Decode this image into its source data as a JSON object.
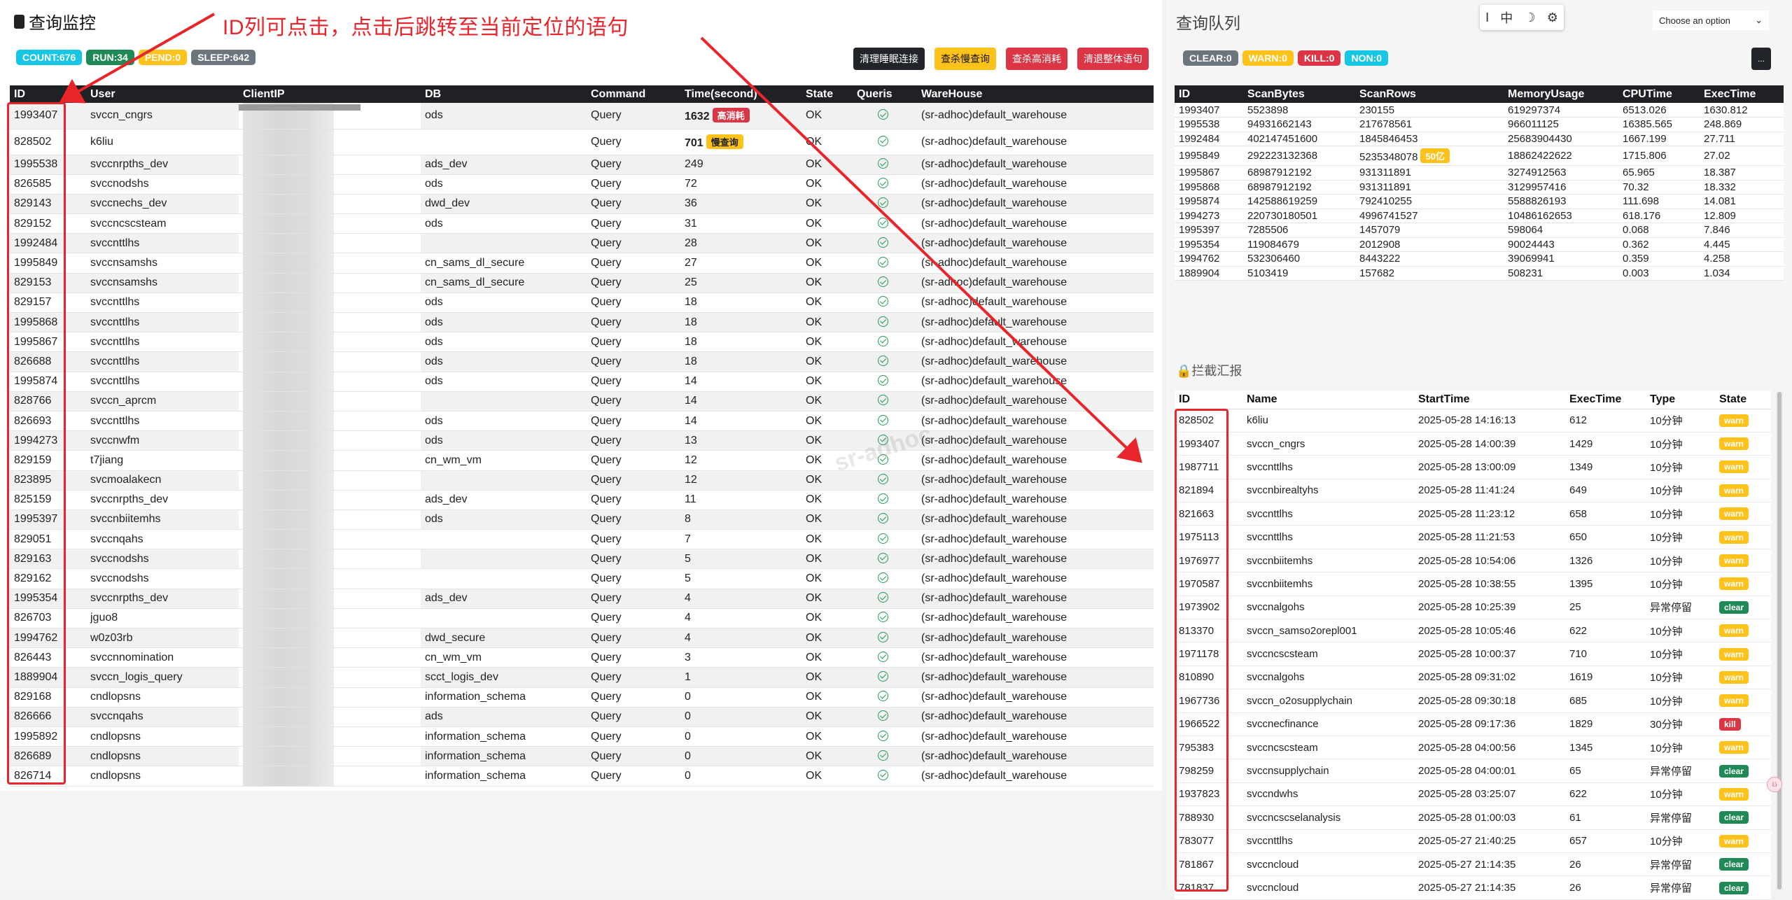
{
  "monitor": {
    "title": "查询监控",
    "annotation": "ID列可点击，点击后跳转至当前定位的语句",
    "badges": {
      "count": "COUNT:676",
      "run": "RUN:34",
      "pend": "PEND:0",
      "sleep": "SLEEP:642"
    },
    "buttons": {
      "clean_sleep": "清理睡眠连接",
      "check_slow": "查杀慢查询",
      "check_high": "查杀高消耗",
      "clean_all": "清退整体语句"
    },
    "columns": [
      "ID",
      "User",
      "ClientIP",
      "DB",
      "Command",
      "Time(second)",
      "State",
      "Queris",
      "WareHouse"
    ],
    "rows": [
      {
        "id": "1993407",
        "user": "svccn_cngrs",
        "db": "ods",
        "cmd": "Query",
        "time": "1632",
        "tag": "高消耗",
        "state": "OK",
        "wh": "(sr-adhoc)default_warehouse"
      },
      {
        "id": "828502",
        "user": "k6liu",
        "db": "",
        "cmd": "Query",
        "time": "701",
        "tag": "慢查询",
        "state": "OK",
        "wh": "(sr-adhoc)default_warehouse"
      },
      {
        "id": "1995538",
        "user": "svccnrpths_dev",
        "db": "ads_dev",
        "cmd": "Query",
        "time": "249",
        "tag": "",
        "state": "OK",
        "wh": "(sr-adhoc)default_warehouse"
      },
      {
        "id": "826585",
        "user": "svccnodshs",
        "db": "ods",
        "cmd": "Query",
        "time": "72",
        "tag": "",
        "state": "OK",
        "wh": "(sr-adhoc)default_warehouse"
      },
      {
        "id": "829143",
        "user": "svccnechs_dev",
        "db": "dwd_dev",
        "cmd": "Query",
        "time": "36",
        "tag": "",
        "state": "OK",
        "wh": "(sr-adhoc)default_warehouse"
      },
      {
        "id": "829152",
        "user": "svccncscsteam",
        "db": "ods",
        "cmd": "Query",
        "time": "31",
        "tag": "",
        "state": "OK",
        "wh": "(sr-adhoc)default_warehouse"
      },
      {
        "id": "1992484",
        "user": "svccnttlhs",
        "db": "",
        "cmd": "Query",
        "time": "28",
        "tag": "",
        "state": "OK",
        "wh": "(sr-adhoc)default_warehouse"
      },
      {
        "id": "1995849",
        "user": "svccnsamshs",
        "db": "cn_sams_dl_secure",
        "cmd": "Query",
        "time": "27",
        "tag": "",
        "state": "OK",
        "wh": "(sr-adhoc)default_warehouse"
      },
      {
        "id": "829153",
        "user": "svccnsamshs",
        "db": "cn_sams_dl_secure",
        "cmd": "Query",
        "time": "25",
        "tag": "",
        "state": "OK",
        "wh": "(sr-adhoc)default_warehouse"
      },
      {
        "id": "829157",
        "user": "svccnttlhs",
        "db": "ods",
        "cmd": "Query",
        "time": "18",
        "tag": "",
        "state": "OK",
        "wh": "(sr-adhoc)default_warehouse"
      },
      {
        "id": "1995868",
        "user": "svccnttlhs",
        "db": "ods",
        "cmd": "Query",
        "time": "18",
        "tag": "",
        "state": "OK",
        "wh": "(sr-adhoc)default_warehouse"
      },
      {
        "id": "1995867",
        "user": "svccnttlhs",
        "db": "ods",
        "cmd": "Query",
        "time": "18",
        "tag": "",
        "state": "OK",
        "wh": "(sr-adhoc)default_warehouse"
      },
      {
        "id": "826688",
        "user": "svccnttlhs",
        "db": "ods",
        "cmd": "Query",
        "time": "18",
        "tag": "",
        "state": "OK",
        "wh": "(sr-adhoc)default_warehouse"
      },
      {
        "id": "1995874",
        "user": "svccnttlhs",
        "db": "ods",
        "cmd": "Query",
        "time": "14",
        "tag": "",
        "state": "OK",
        "wh": "(sr-adhoc)default_warehouse"
      },
      {
        "id": "828766",
        "user": "svccn_aprcm",
        "db": "",
        "cmd": "Query",
        "time": "14",
        "tag": "",
        "state": "OK",
        "wh": "(sr-adhoc)default_warehouse"
      },
      {
        "id": "826693",
        "user": "svccnttlhs",
        "db": "ods",
        "cmd": "Query",
        "time": "14",
        "tag": "",
        "state": "OK",
        "wh": "(sr-adhoc)default_warehouse"
      },
      {
        "id": "1994273",
        "user": "svccnwfm",
        "db": "ods",
        "cmd": "Query",
        "time": "13",
        "tag": "",
        "state": "OK",
        "wh": "(sr-adhoc)default_warehouse"
      },
      {
        "id": "829159",
        "user": "t7jiang",
        "db": "cn_wm_vm",
        "cmd": "Query",
        "time": "12",
        "tag": "",
        "state": "OK",
        "wh": "(sr-adhoc)default_warehouse"
      },
      {
        "id": "823895",
        "user": "svcmoalakecn",
        "db": "",
        "cmd": "Query",
        "time": "12",
        "tag": "",
        "state": "OK",
        "wh": "(sr-adhoc)default_warehouse"
      },
      {
        "id": "825159",
        "user": "svccnrpths_dev",
        "db": "ads_dev",
        "cmd": "Query",
        "time": "11",
        "tag": "",
        "state": "OK",
        "wh": "(sr-adhoc)default_warehouse"
      },
      {
        "id": "1995397",
        "user": "svccnbiitemhs",
        "db": "ods",
        "cmd": "Query",
        "time": "8",
        "tag": "",
        "state": "OK",
        "wh": "(sr-adhoc)default_warehouse"
      },
      {
        "id": "829051",
        "user": "svccnqahs",
        "db": "",
        "cmd": "Query",
        "time": "7",
        "tag": "",
        "state": "OK",
        "wh": "(sr-adhoc)default_warehouse"
      },
      {
        "id": "829163",
        "user": "svccnodshs",
        "db": "",
        "cmd": "Query",
        "time": "5",
        "tag": "",
        "state": "OK",
        "wh": "(sr-adhoc)default_warehouse"
      },
      {
        "id": "829162",
        "user": "svccnodshs",
        "db": "",
        "cmd": "Query",
        "time": "5",
        "tag": "",
        "state": "OK",
        "wh": "(sr-adhoc)default_warehouse"
      },
      {
        "id": "1995354",
        "user": "svccnrpths_dev",
        "db": "ads_dev",
        "cmd": "Query",
        "time": "4",
        "tag": "",
        "state": "OK",
        "wh": "(sr-adhoc)default_warehouse"
      },
      {
        "id": "826703",
        "user": "jguo8",
        "db": "",
        "cmd": "Query",
        "time": "4",
        "tag": "",
        "state": "OK",
        "wh": "(sr-adhoc)default_warehouse"
      },
      {
        "id": "1994762",
        "user": "w0z03rb",
        "db": "dwd_secure",
        "cmd": "Query",
        "time": "4",
        "tag": "",
        "state": "OK",
        "wh": "(sr-adhoc)default_warehouse"
      },
      {
        "id": "826443",
        "user": "svccnnomination",
        "db": "cn_wm_vm",
        "cmd": "Query",
        "time": "3",
        "tag": "",
        "state": "OK",
        "wh": "(sr-adhoc)default_warehouse"
      },
      {
        "id": "1889904",
        "user": "svccn_logis_query",
        "db": "scct_logis_dev",
        "cmd": "Query",
        "time": "1",
        "tag": "",
        "state": "OK",
        "wh": "(sr-adhoc)default_warehouse"
      },
      {
        "id": "829168",
        "user": "cndlopsns",
        "db": "information_schema",
        "cmd": "Query",
        "time": "0",
        "tag": "",
        "state": "OK",
        "wh": "(sr-adhoc)default_warehouse"
      },
      {
        "id": "826666",
        "user": "svccnqahs",
        "db": "ads",
        "cmd": "Query",
        "time": "0",
        "tag": "",
        "state": "OK",
        "wh": "(sr-adhoc)default_warehouse"
      },
      {
        "id": "1995892",
        "user": "cndlopsns",
        "db": "information_schema",
        "cmd": "Query",
        "time": "0",
        "tag": "",
        "state": "OK",
        "wh": "(sr-adhoc)default_warehouse"
      },
      {
        "id": "826689",
        "user": "cndlopsns",
        "db": "information_schema",
        "cmd": "Query",
        "time": "0",
        "tag": "",
        "state": "OK",
        "wh": "(sr-adhoc)default_warehouse"
      },
      {
        "id": "826714",
        "user": "cndlopsns",
        "db": "information_schema",
        "cmd": "Query",
        "time": "0",
        "tag": "",
        "state": "OK",
        "wh": "(sr-adhoc)default_warehouse"
      }
    ],
    "watermark": "sr-adhoc"
  },
  "queue": {
    "title": "查询队列",
    "toolbar": {
      "cursor": "I",
      "lang": "中",
      "moon": "☽",
      "gear": "⚙"
    },
    "select": {
      "value": "Choose an option",
      "caret": "⌄"
    },
    "badges": {
      "clear": "CLEAR:0",
      "warn": "WARN:0",
      "kill": "KILL:0",
      "non": "NON:0"
    },
    "dark_button": "...",
    "columns": [
      "ID",
      "ScanBytes",
      "ScanRows",
      "MemoryUsage",
      "CPUTime",
      "ExecTime"
    ],
    "rows": [
      {
        "id": "1993407",
        "bytes": "5523898",
        "rows": "230155",
        "tag": "",
        "mem": "619297374",
        "cpu": "6513.026",
        "exec": "1630.812"
      },
      {
        "id": "1995538",
        "bytes": "94931662143",
        "rows": "217678561",
        "tag": "",
        "mem": "966011125",
        "cpu": "16385.565",
        "exec": "248.869"
      },
      {
        "id": "1992484",
        "bytes": "402147451600",
        "rows": "1845846453",
        "tag": "",
        "mem": "25683904430",
        "cpu": "1667.199",
        "exec": "27.711"
      },
      {
        "id": "1995849",
        "bytes": "292223132368",
        "rows": "5235348078",
        "tag": "50亿",
        "mem": "18862422622",
        "cpu": "1715.806",
        "exec": "27.02"
      },
      {
        "id": "1995867",
        "bytes": "68987912192",
        "rows": "931311891",
        "tag": "",
        "mem": "3274912563",
        "cpu": "65.965",
        "exec": "18.387"
      },
      {
        "id": "1995868",
        "bytes": "68987912192",
        "rows": "931311891",
        "tag": "",
        "mem": "3129957416",
        "cpu": "70.32",
        "exec": "18.332"
      },
      {
        "id": "1995874",
        "bytes": "142588619259",
        "rows": "792410255",
        "tag": "",
        "mem": "5588826193",
        "cpu": "111.698",
        "exec": "14.081"
      },
      {
        "id": "1994273",
        "bytes": "220730180501",
        "rows": "4996741527",
        "tag": "",
        "mem": "10486162653",
        "cpu": "618.176",
        "exec": "12.809"
      },
      {
        "id": "1995397",
        "bytes": "7285506",
        "rows": "1457079",
        "tag": "",
        "mem": "598064",
        "cpu": "0.068",
        "exec": "7.846"
      },
      {
        "id": "1995354",
        "bytes": "119084679",
        "rows": "2012908",
        "tag": "",
        "mem": "90024443",
        "cpu": "0.362",
        "exec": "4.445"
      },
      {
        "id": "1994762",
        "bytes": "532306460",
        "rows": "8443222",
        "tag": "",
        "mem": "39069941",
        "cpu": "0.359",
        "exec": "4.258"
      },
      {
        "id": "1889904",
        "bytes": "5103419",
        "rows": "157682",
        "tag": "",
        "mem": "508231",
        "cpu": "0.003",
        "exec": "1.034"
      }
    ]
  },
  "intercept": {
    "title": "🔒拦截汇报",
    "columns": [
      "ID",
      "Name",
      "StartTime",
      "ExecTime",
      "Type",
      "State"
    ],
    "rows": [
      {
        "id": "828502",
        "name": "k6liu",
        "start": "2025-05-28 14:16:13",
        "exec": "612",
        "type": "10分钟",
        "state": "warn"
      },
      {
        "id": "1993407",
        "name": "svccn_cngrs",
        "start": "2025-05-28 14:00:39",
        "exec": "1429",
        "type": "10分钟",
        "state": "warn"
      },
      {
        "id": "1987711",
        "name": "svccnttlhs",
        "start": "2025-05-28 13:00:09",
        "exec": "1349",
        "type": "10分钟",
        "state": "warn"
      },
      {
        "id": "821894",
        "name": "svccnbirealtyhs",
        "start": "2025-05-28 11:41:24",
        "exec": "649",
        "type": "10分钟",
        "state": "warn"
      },
      {
        "id": "821663",
        "name": "svccnttlhs",
        "start": "2025-05-28 11:23:12",
        "exec": "658",
        "type": "10分钟",
        "state": "warn"
      },
      {
        "id": "1975113",
        "name": "svccnttlhs",
        "start": "2025-05-28 11:21:53",
        "exec": "650",
        "type": "10分钟",
        "state": "warn"
      },
      {
        "id": "1976977",
        "name": "svccnbiitemhs",
        "start": "2025-05-28 10:54:06",
        "exec": "1326",
        "type": "10分钟",
        "state": "warn"
      },
      {
        "id": "1970587",
        "name": "svccnbiitemhs",
        "start": "2025-05-28 10:38:55",
        "exec": "1395",
        "type": "10分钟",
        "state": "warn"
      },
      {
        "id": "1973902",
        "name": "svccnalgohs",
        "start": "2025-05-28 10:25:39",
        "exec": "25",
        "type": "异常停留",
        "state": "clear"
      },
      {
        "id": "813370",
        "name": "svccn_samso2orepl001",
        "start": "2025-05-28 10:05:46",
        "exec": "622",
        "type": "10分钟",
        "state": "warn"
      },
      {
        "id": "1971178",
        "name": "svccncscsteam",
        "start": "2025-05-28 10:00:37",
        "exec": "710",
        "type": "10分钟",
        "state": "warn"
      },
      {
        "id": "810890",
        "name": "svccnalgohs",
        "start": "2025-05-28 09:31:02",
        "exec": "1619",
        "type": "10分钟",
        "state": "warn"
      },
      {
        "id": "1967736",
        "name": "svccn_o2osupplychain",
        "start": "2025-05-28 09:30:18",
        "exec": "685",
        "type": "10分钟",
        "state": "warn"
      },
      {
        "id": "1966522",
        "name": "svccnecfinance",
        "start": "2025-05-28 09:17:36",
        "exec": "1829",
        "type": "30分钟",
        "state": "kill"
      },
      {
        "id": "795383",
        "name": "svccncscsteam",
        "start": "2025-05-28 04:00:56",
        "exec": "1345",
        "type": "10分钟",
        "state": "warn"
      },
      {
        "id": "798259",
        "name": "svccnsupplychain",
        "start": "2025-05-28 04:00:01",
        "exec": "65",
        "type": "异常停留",
        "state": "clear"
      },
      {
        "id": "1937823",
        "name": "svccndwhs",
        "start": "2025-05-28 03:25:07",
        "exec": "622",
        "type": "10分钟",
        "state": "warn"
      },
      {
        "id": "788930",
        "name": "svccncscselanalysis",
        "start": "2025-05-28 01:00:03",
        "exec": "61",
        "type": "异常停留",
        "state": "clear"
      },
      {
        "id": "783077",
        "name": "svccnttlhs",
        "start": "2025-05-27 21:40:25",
        "exec": "657",
        "type": "10分钟",
        "state": "warn"
      },
      {
        "id": "781867",
        "name": "svccncloud",
        "start": "2025-05-27 21:14:35",
        "exec": "26",
        "type": "异常停留",
        "state": "clear"
      },
      {
        "id": "781837",
        "name": "svccncloud",
        "start": "2025-05-27 21:14:35",
        "exec": "26",
        "type": "异常停留",
        "state": "clear"
      }
    ]
  },
  "float_icon": "ઇ",
  "colors": {
    "annotation": "#e8252b",
    "header_bg": "#1f2125",
    "warn": "#ffc21a",
    "clear": "#1f8a55",
    "kill": "#dc3545",
    "count": "#17c6e5"
  }
}
